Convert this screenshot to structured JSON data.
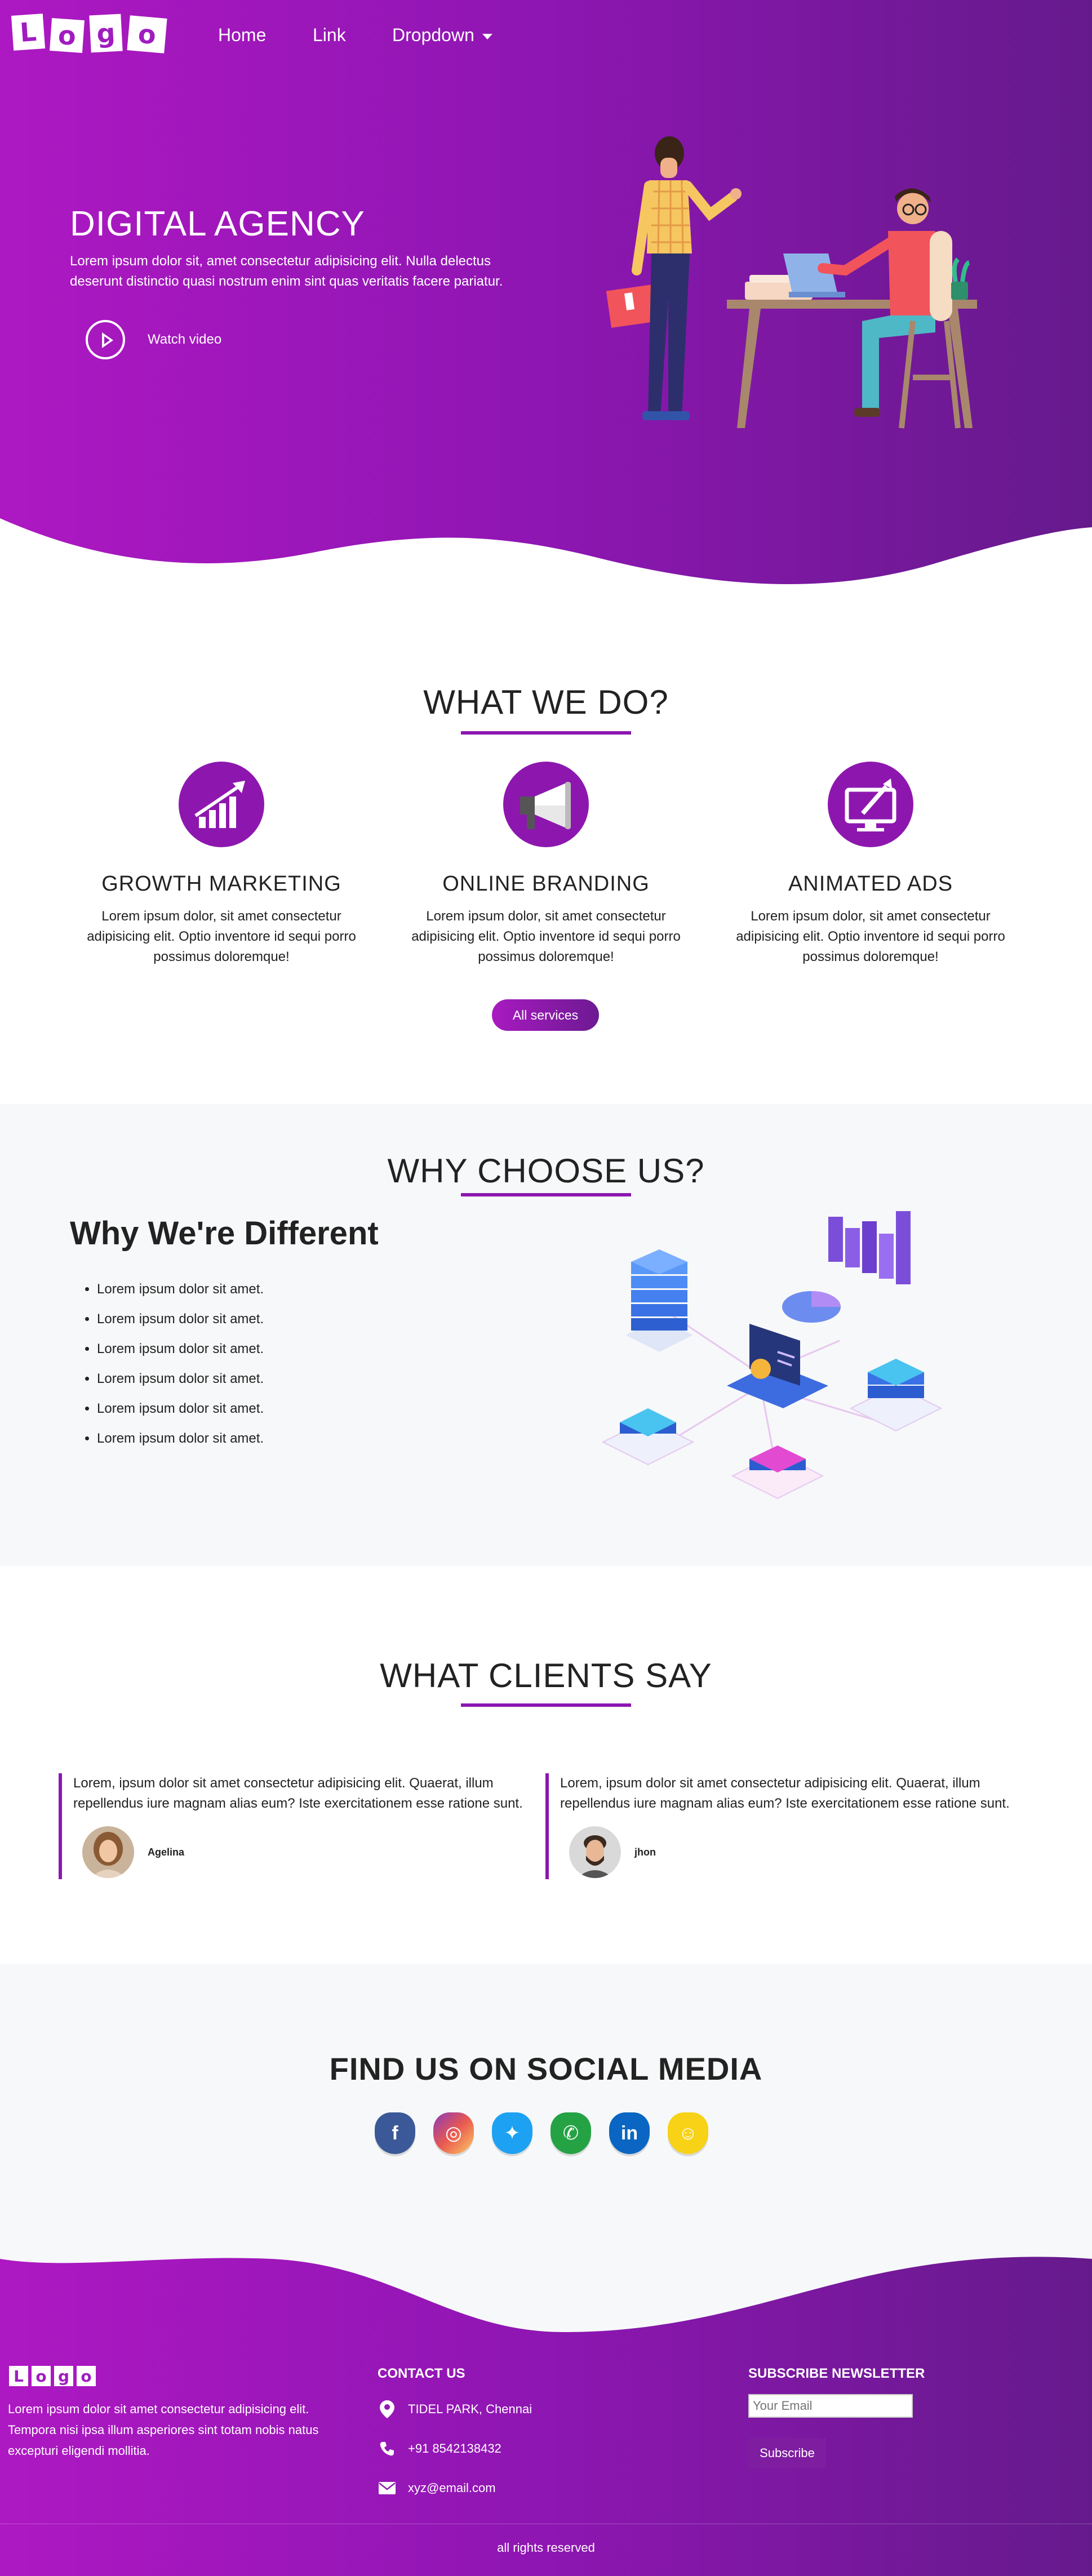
{
  "nav": {
    "logo_letters": [
      "L",
      "o",
      "g",
      "o"
    ],
    "home": "Home",
    "link": "Link",
    "dropdown": "Dropdown"
  },
  "hero": {
    "title": "DIGITAL AGENCY",
    "text": "Lorem ipsum dolor sit, amet consectetur adipisicing elit. Nulla delectus deserunt distinctio quasi nostrum enim sint quas veritatis facere pariatur.",
    "watch_label": "Watch video"
  },
  "services": {
    "title": "WHAT WE DO?",
    "items": [
      {
        "icon": "growth-chart-icon",
        "title": "GROWTH MARKETING",
        "text": "Lorem ipsum dolor, sit amet consectetur adipisicing elit. Optio inventore id sequi porro possimus doloremque!"
      },
      {
        "icon": "megaphone-icon",
        "title": "ONLINE BRANDING",
        "text": "Lorem ipsum dolor, sit amet consectetur adipisicing elit. Optio inventore id sequi porro possimus doloremque!"
      },
      {
        "icon": "monitor-pen-icon",
        "title": "ANIMATED ADS",
        "text": "Lorem ipsum dolor, sit amet consectetur adipisicing elit. Optio inventore id sequi porro possimus doloremque!"
      }
    ],
    "button": "All services"
  },
  "why": {
    "title": "WHY CHOOSE US?",
    "heading": "Why We're Different",
    "items": [
      "Lorem ipsum dolor sit amet.",
      "Lorem ipsum dolor sit amet.",
      "Lorem ipsum dolor sit amet.",
      "Lorem ipsum dolor sit amet.",
      "Lorem ipsum dolor sit amet.",
      "Lorem ipsum dolor sit amet."
    ]
  },
  "clients": {
    "title": "WHAT CLIENTS SAY",
    "items": [
      {
        "text": "Lorem, ipsum dolor sit amet consectetur adipisicing elit. Quaerat, illum repellendus iure magnam alias eum? Iste exercitationem esse ratione sunt.",
        "name": "Agelina"
      },
      {
        "text": "Lorem, ipsum dolor sit amet consectetur adipisicing elit. Quaerat, illum repellendus iure magnam alias eum? Iste exercitationem esse ratione sunt.",
        "name": "jhon"
      }
    ]
  },
  "social": {
    "title": "FIND US ON SOCIAL MEDIA",
    "icons": [
      {
        "name": "facebook-icon",
        "glyph": "f",
        "color": "#3b5998"
      },
      {
        "name": "instagram-icon",
        "glyph": "◎",
        "color": "#d6336c"
      },
      {
        "name": "twitter-icon",
        "glyph": "✦",
        "color": "#1da1f2"
      },
      {
        "name": "whatsapp-icon",
        "glyph": "✆",
        "color": "#25a244"
      },
      {
        "name": "linkedin-icon",
        "glyph": "in",
        "color": "#0a66c2"
      },
      {
        "name": "snapchat-icon",
        "glyph": "☺",
        "color": "#f7d216"
      }
    ]
  },
  "footer": {
    "text": "Lorem ipsum dolor sit amet consectetur adipisicing elit. Tempora nisi ipsa illum asperiores sint totam nobis natus excepturi eligendi mollitia.",
    "contact_title": "CONTACT US",
    "address": "TIDEL PARK, Chennai",
    "phone": "+91 8542138432",
    "email": "xyz@email.com",
    "newsletter_title": "SUBSCRIBE NEWSLETTER",
    "email_placeholder": "Your Email",
    "subscribe": "Subscribe",
    "copyright": "all rights reserved"
  },
  "colors": {
    "accent": "#8c16b0",
    "gradient_start": "#ad18c2",
    "gradient_end": "#651a8c"
  }
}
